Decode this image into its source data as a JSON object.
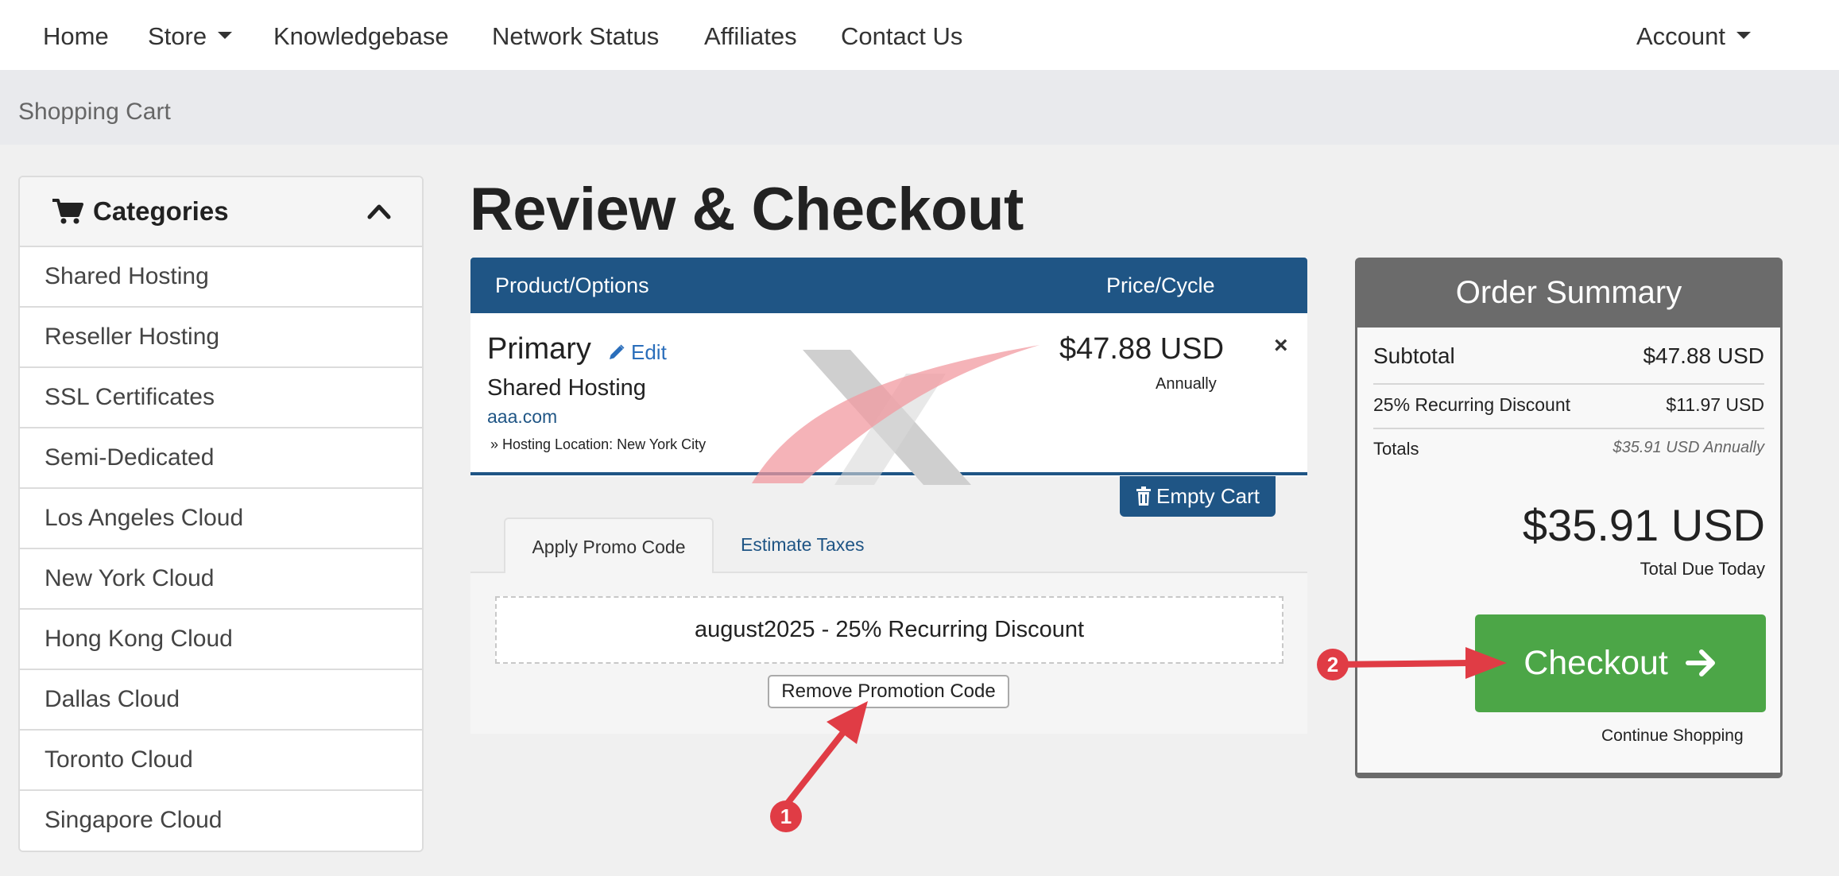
{
  "nav": {
    "items": [
      {
        "label": "Home",
        "has_caret": false
      },
      {
        "label": "Store",
        "has_caret": true
      },
      {
        "label": "Knowledgebase",
        "has_caret": false
      },
      {
        "label": "Network Status",
        "has_caret": false
      },
      {
        "label": "Affiliates",
        "has_caret": false
      },
      {
        "label": "Contact Us",
        "has_caret": false
      }
    ],
    "account_label": "Account"
  },
  "breadcrumb": "Shopping Cart",
  "sidebar": {
    "title": "Categories",
    "icon": "shopping-cart-icon",
    "collapse_icon": "chevron-up-icon",
    "items": [
      "Shared Hosting",
      "Reseller Hosting",
      "SSL Certificates",
      "Semi-Dedicated",
      "Los Angeles Cloud",
      "New York Cloud",
      "Hong Kong Cloud",
      "Dallas Cloud",
      "Toronto Cloud",
      "Singapore Cloud"
    ]
  },
  "page_title": "Review & Checkout",
  "cart": {
    "col_product": "Product/Options",
    "col_price": "Price/Cycle",
    "item": {
      "name": "Primary",
      "edit_label": "Edit",
      "group": "Shared Hosting",
      "domain": "aaa.com",
      "option": "» Hosting Location: New York City",
      "price": "$47.88 USD",
      "cycle": "Annually",
      "remove_glyph": "×"
    },
    "empty_label": "Empty Cart"
  },
  "tabs": {
    "promo": "Apply Promo Code",
    "taxes": "Estimate Taxes"
  },
  "promo": {
    "applied": "august2025 - 25% Recurring Discount",
    "remove_label": "Remove Promotion Code"
  },
  "summary": {
    "title": "Order Summary",
    "subtotal_label": "Subtotal",
    "subtotal_value": "$47.88 USD",
    "discount_label": "25% Recurring Discount",
    "discount_value": "$11.97 USD",
    "totals_label": "Totals",
    "totals_value": "$35.91 USD Annually",
    "grand_total": "$35.91 USD",
    "due_label": "Total Due Today",
    "checkout_label": "Checkout",
    "continue_label": "Continue Shopping"
  },
  "annotations": {
    "marker_1": "1",
    "marker_2": "2"
  },
  "colors": {
    "header_blue": "#1f5585",
    "checkout_green": "#4ca647",
    "summary_gray": "#6b6b6b",
    "annotation_red": "#e03c45"
  }
}
